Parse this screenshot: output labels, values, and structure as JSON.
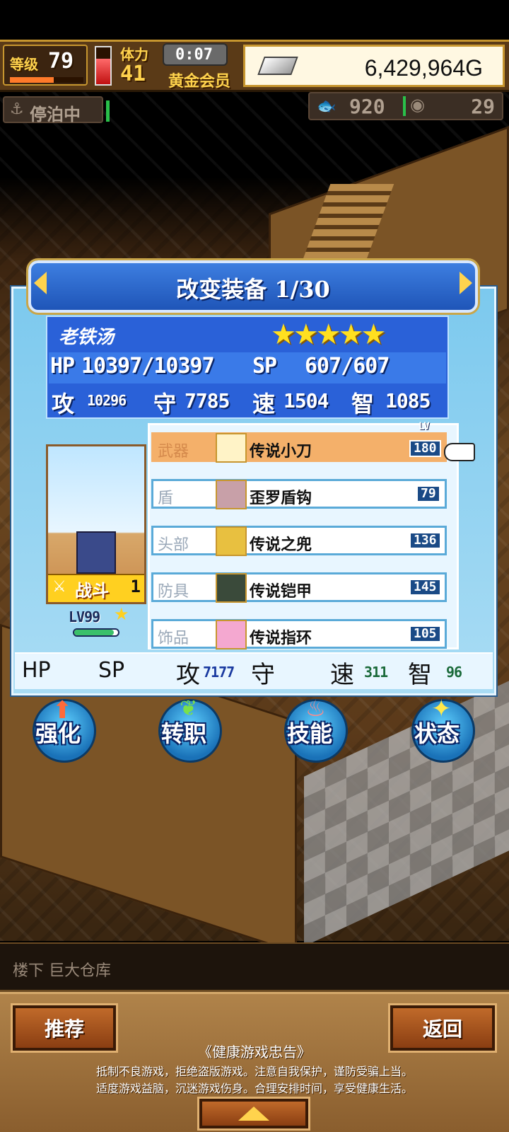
{
  "hud": {
    "level_label": "等级",
    "level": "79",
    "stamina_label": "体力",
    "stamina": "41",
    "timer": "0:07",
    "membership": "黄金会员",
    "gold": "6,429,964G",
    "status": "停泊中",
    "resource_a": "920",
    "resource_b": "29"
  },
  "dialog": {
    "title": "改变装备 1/30",
    "character": {
      "name": "老铁汤",
      "stars": 5,
      "hp": "10397/10397",
      "sp": "607/607",
      "hp_label": "HP",
      "sp_label": "SP",
      "atk_label": "攻",
      "atk": "10296",
      "def_label": "守",
      "def": "7785",
      "spd_label": "速",
      "spd": "1504",
      "int_label": "智",
      "int": "1085",
      "battle_label": "战斗",
      "battle_num": "1",
      "level": "LV99"
    },
    "equipment": [
      {
        "slot": "武器",
        "name": "传说小刀",
        "value": "180",
        "selected": true
      },
      {
        "slot": "盾",
        "name": "歪罗盾钩",
        "value": "79",
        "selected": false
      },
      {
        "slot": "头部",
        "name": "传说之兜",
        "value": "136",
        "selected": false
      },
      {
        "slot": "防具",
        "name": "传说铠甲",
        "value": "145",
        "selected": false
      },
      {
        "slot": "饰品",
        "name": "传说指环",
        "value": "105",
        "selected": false
      }
    ],
    "lv_tag": "LV",
    "bonus": {
      "hp_label": "HP",
      "sp_label": "SP",
      "atk_label": "攻",
      "atk": "7177",
      "def_label": "守",
      "spd_label": "速",
      "spd": "311",
      "int_label": "智",
      "int": "96"
    }
  },
  "actions": [
    {
      "label": "强化"
    },
    {
      "label": "转职"
    },
    {
      "label": "技能"
    },
    {
      "label": "状态"
    }
  ],
  "location": "楼下 巨大仓库",
  "footer": {
    "recommend": "推荐",
    "back": "返回",
    "notice_title": "《健康游戏忠告》",
    "notice_line1": "抵制不良游戏，拒绝盗版游戏。注意自我保护，谨防受骗上当。",
    "notice_line2": "适度游戏益脑，沉迷游戏伤身。合理安排时间，享受健康生活。"
  },
  "colors": {
    "accent_gold": "#ffd34d",
    "panel_blue": "#2a61d8",
    "selected_row": "#f4b06a"
  }
}
